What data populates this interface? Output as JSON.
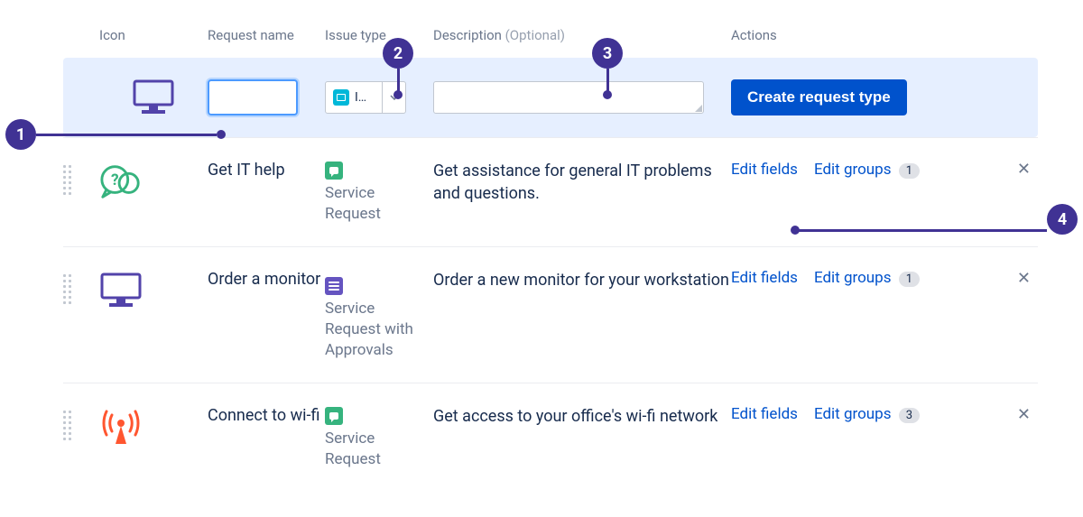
{
  "columns": {
    "icon": "Icon",
    "name": "Request name",
    "issue": "Issue type",
    "desc_label": "Description",
    "desc_optional": "(Optional)",
    "actions": "Actions"
  },
  "create": {
    "issue_placeholder": "I…",
    "button": "Create request type"
  },
  "action_labels": {
    "edit_fields": "Edit fields",
    "edit_groups": "Edit groups"
  },
  "rows": [
    {
      "name": "Get IT help",
      "issue_type": "Service Request",
      "issue_color": "green",
      "description": "Get assistance for general IT problems and questions.",
      "groups_count": "1"
    },
    {
      "name": "Order a monitor",
      "issue_type": "Service Request with Approvals",
      "issue_color": "purple",
      "description": "Order a new monitor for your workstation",
      "groups_count": "1"
    },
    {
      "name": "Connect to wi-fi",
      "issue_type": "Service Request",
      "issue_color": "green",
      "description": "Get access to your office's wi-fi network",
      "groups_count": "3"
    }
  ],
  "callouts": {
    "c1": "1",
    "c2": "2",
    "c3": "3",
    "c4": "4"
  }
}
